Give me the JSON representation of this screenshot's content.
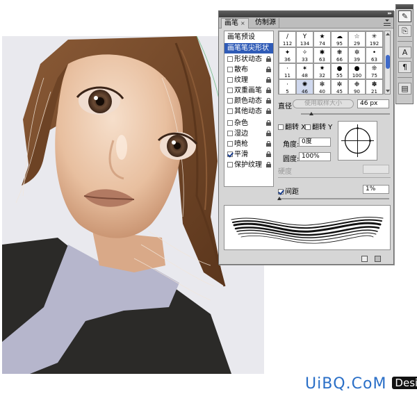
{
  "panel": {
    "tabs": [
      {
        "label": "画笔"
      },
      {
        "label": "仿制源"
      }
    ],
    "close_glyph": "×",
    "collapse_glyph": "▸▸",
    "sidebar": {
      "title": "画笔预设",
      "items": [
        {
          "label": "画笔笔尖形状",
          "selected": true
        },
        {
          "label": "形状动态",
          "checked": false,
          "locked": true
        },
        {
          "label": "散布",
          "checked": false,
          "locked": true
        },
        {
          "label": "纹理",
          "checked": false,
          "locked": true
        },
        {
          "label": "双重画笔",
          "checked": false,
          "locked": true
        },
        {
          "label": "颜色动态",
          "checked": false,
          "locked": true
        },
        {
          "label": "其他动态",
          "checked": false,
          "locked": true
        },
        {
          "label": "杂色",
          "checked": false,
          "locked": true
        },
        {
          "label": "湿边",
          "checked": false,
          "locked": true
        },
        {
          "label": "喷枪",
          "checked": false,
          "locked": true
        },
        {
          "label": "平滑",
          "checked": true,
          "locked": true
        },
        {
          "label": "保护纹理",
          "checked": false,
          "locked": true
        }
      ]
    },
    "presets": [
      {
        "size": "112",
        "shape": "/"
      },
      {
        "size": "134",
        "shape": "Y"
      },
      {
        "size": "74",
        "shape": "★"
      },
      {
        "size": "95",
        "shape": "☁"
      },
      {
        "size": "29",
        "shape": "☆"
      },
      {
        "size": "192",
        "shape": "✳"
      },
      {
        "size": "36",
        "shape": "✦"
      },
      {
        "size": "33",
        "shape": "✧"
      },
      {
        "size": "63",
        "shape": "✱"
      },
      {
        "size": "66",
        "shape": "❋"
      },
      {
        "size": "39",
        "shape": "✲"
      },
      {
        "size": "63",
        "shape": "•"
      },
      {
        "size": "11",
        "shape": "·"
      },
      {
        "size": "48",
        "shape": "✶"
      },
      {
        "size": "32",
        "shape": "✷"
      },
      {
        "size": "55",
        "shape": "●"
      },
      {
        "size": "100",
        "shape": "●"
      },
      {
        "size": "75",
        "shape": "❊"
      },
      {
        "size": "5",
        "shape": "·"
      },
      {
        "size": "46",
        "shape": "✺"
      },
      {
        "size": "40",
        "shape": "✻"
      },
      {
        "size": "45",
        "shape": "✼"
      },
      {
        "size": "90",
        "shape": "❉"
      },
      {
        "size": "21",
        "shape": "✽"
      }
    ],
    "selected_preset_index": 19,
    "diameter": {
      "label": "直径",
      "button": "使用取样大小",
      "value": "46 px",
      "level": 0.12
    },
    "flip_x": {
      "label": "翻转 X",
      "checked": false
    },
    "flip_y": {
      "label": "翻转 Y",
      "checked": false
    },
    "angle": {
      "label": "角度:",
      "value": "0度"
    },
    "roundness": {
      "label": "圆度:",
      "value": "100%"
    },
    "hardness": {
      "label": "硬度",
      "value": ""
    },
    "spacing": {
      "label": "间距",
      "checked": true,
      "value": "1%",
      "level": 0.01
    }
  },
  "dock": {
    "buttons": [
      {
        "name": "brush-tool-icon",
        "glyph": "✎",
        "selected": true
      },
      {
        "name": "clone-source-icon",
        "glyph": "⎘",
        "selected": false
      },
      {
        "name": "character-icon",
        "glyph": "A",
        "selected": false
      },
      {
        "name": "paragraph-icon",
        "glyph": "¶",
        "selected": false
      },
      {
        "name": "layer-comps-icon",
        "glyph": "▤",
        "selected": false
      }
    ]
  },
  "watermark": {
    "text": "UiBQ.CoM",
    "logo": "Design"
  },
  "colors": {
    "selection": "#2f5bb7",
    "panel_bg": "#d6d6d6",
    "watermark": "#2a6fc7"
  }
}
